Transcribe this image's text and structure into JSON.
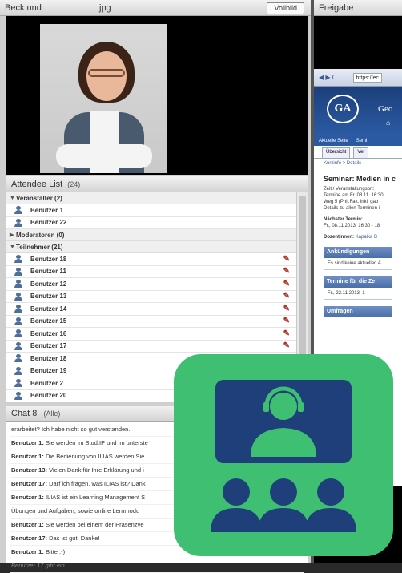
{
  "video": {
    "title": "Beck und",
    "title_suffix": "jpg",
    "fullscreen_label": "Vollbild"
  },
  "attendees": {
    "title": "Attendee List",
    "count": "(24)",
    "groups": [
      {
        "label": "Veranstalter (2)",
        "expanded": true,
        "users": [
          "Benutzer 1",
          "Benutzer 22"
        ]
      },
      {
        "label": "Moderatoren (0)",
        "expanded": false,
        "users": []
      },
      {
        "label": "Teilnehmer (21)",
        "expanded": true,
        "users": [
          "Benutzer 18",
          "Benutzer 11",
          "Benutzer 12",
          "Benutzer 13",
          "Benutzer 14",
          "Benutzer 15",
          "Benutzer 16",
          "Benutzer 17",
          "Benutzer 18",
          "Benutzer 19",
          "Benutzer 2",
          "Benutzer 20"
        ]
      }
    ]
  },
  "chat": {
    "title": "Chat 8",
    "count": "(Alle)",
    "messages": [
      {
        "user": "",
        "text": "erarbeitet? Ich habe nicht so gut verstanden."
      },
      {
        "user": "Benutzer 1:",
        "text": "Sie werden im Stud.IP und im unterste"
      },
      {
        "user": "Benutzer 1:",
        "text": "Die Bedienung von ILIAS werden Sie"
      },
      {
        "user": "Benutzer 13:",
        "text": "Vielen Dank für Ihre Erklärung und i"
      },
      {
        "user": "Benutzer 17:",
        "text": "Darf ich fragen, was ILIAS ist? Dank"
      },
      {
        "user": "Benutzer 1:",
        "text": "ILIAS ist ein Learning Management S"
      },
      {
        "user": "",
        "text": "Übungen und Aufgaben, sowie online Lernmodu"
      },
      {
        "user": "Benutzer 1:",
        "text": "Sie werden bei einem der Präsenzve"
      },
      {
        "user": "Benutzer 17:",
        "text": "Das ist gut. Danke!"
      },
      {
        "user": "Benutzer 1:",
        "text": "Bitte :-)"
      }
    ],
    "typing": "Benutzer 17 gibt ein..."
  },
  "share": {
    "title": "Freigabe",
    "browser": {
      "url": "https://ec"
    },
    "site": {
      "logo": "GA",
      "title": "Geo",
      "nav": [
        "Aktuelle Seite",
        "Semi"
      ],
      "tabs": [
        "Übersicht",
        "Ver"
      ],
      "breadcrumb": "Kurzinfo  > Details",
      "heading": "Seminar: Medien in c",
      "meta": [
        "Zeit / Veranstaltungsort:",
        "Termine am Fr. 08.11. 16:30",
        "Weg 5 (Phil.Fak. inkl. gab",
        "Details zu allen Terminen i"
      ],
      "next_label": "Nächster Termin:",
      "next_value": "Fr., 08.11.2013, 16:30 - 18",
      "lecturers_label": "Dozentinnen:",
      "lecturers_value": "Kapalka B",
      "sections": [
        {
          "title": "Ankündigungen",
          "body": "Es sind keine aktuellen A"
        },
        {
          "title": "Termine für die Ze",
          "body": "Fr., 22.11.2013, 1"
        },
        {
          "title": "Umfragen",
          "body": ""
        }
      ]
    }
  },
  "colors": {
    "icon_bg": "#3ebf72",
    "icon_fg": "#1f3f7a",
    "site_blue": "#2b5aa3",
    "pencil": "#b03020"
  },
  "icons": {
    "overlay": "webinar-presenter-icon",
    "user": "user-icon",
    "edit": "pencil-icon"
  }
}
